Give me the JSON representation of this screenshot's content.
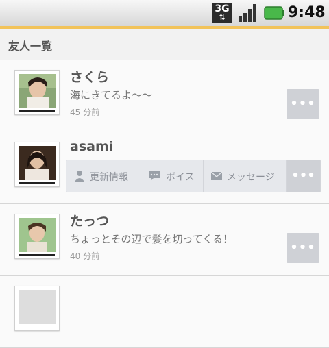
{
  "statusbar": {
    "network": "3G",
    "time": "9:48"
  },
  "header": {
    "title": "友人一覧"
  },
  "friends": [
    {
      "name": "さくら",
      "message": "海にきてるよ〜〜",
      "time": "45 分前"
    },
    {
      "name": "asami"
    },
    {
      "name": "たっつ",
      "message": "ちょっとその辺で髪を切ってくる！",
      "time": "40 分前"
    },
    {
      "name": ""
    }
  ],
  "actions": {
    "update": "更新情報",
    "voice": "ボイス",
    "message": "メッセージ"
  },
  "more_label": "•••",
  "colors": {
    "accent": "#f2c35a",
    "button_bg": "#cfd1d6",
    "text": "#555555"
  }
}
